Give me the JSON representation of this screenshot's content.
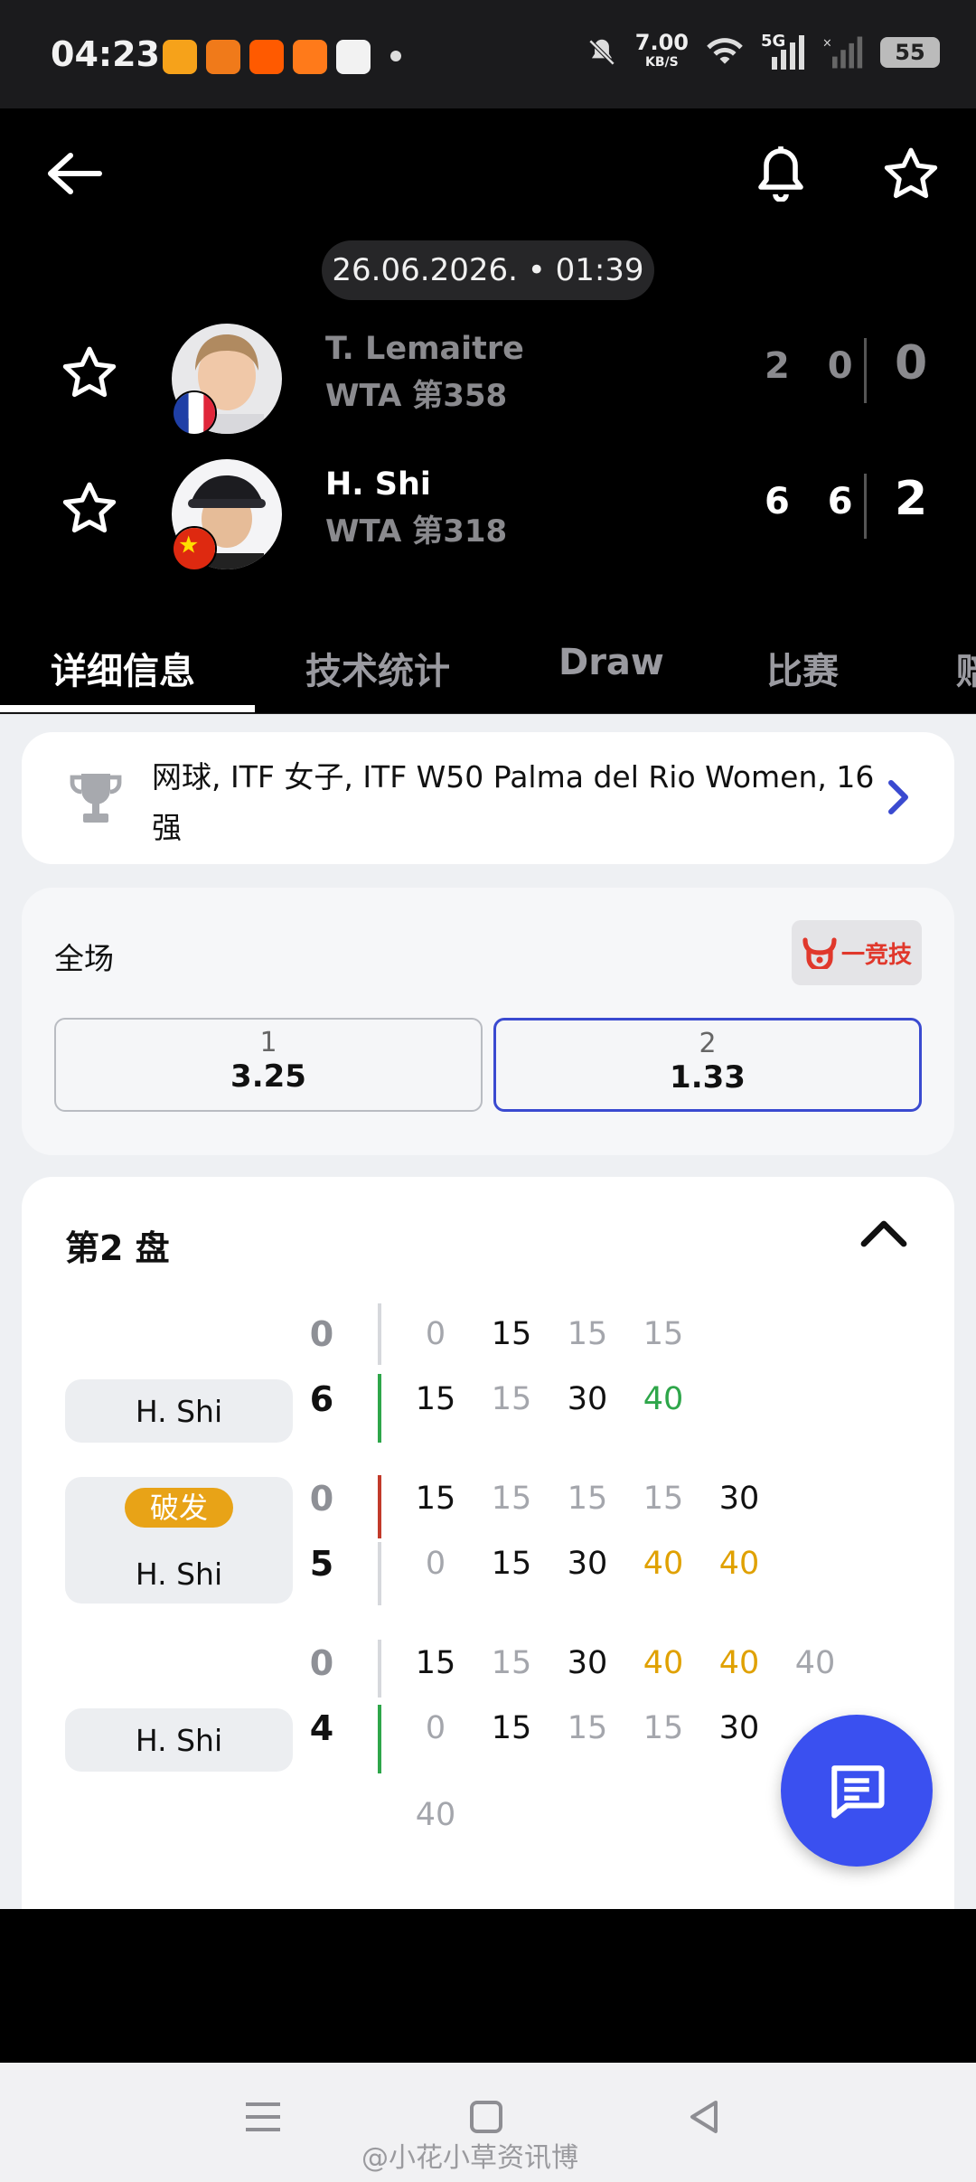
{
  "status_bar": {
    "time": "04:23",
    "speed_value": "7.00",
    "speed_unit": "KB/S",
    "network": "5G",
    "battery": "55",
    "app_icons": [
      "weibo-icon",
      "app-store-icon",
      "taobao-icon",
      "meituan-icon",
      "photos-icon"
    ]
  },
  "header": {
    "datetime": "26.06.2026. • 01:39",
    "players": [
      {
        "name": "T. Lemaitre",
        "rank": "WTA 第358",
        "country": "France",
        "sets": "2 0",
        "total": "0",
        "dimmed": true
      },
      {
        "name": "H. Shi",
        "rank": "WTA 第318",
        "country": "China",
        "sets": "6 6",
        "total": "2",
        "dimmed": false
      }
    ]
  },
  "tabs": [
    "详细信息",
    "技术统计",
    "Draw",
    "比赛",
    "赔"
  ],
  "active_tab": 0,
  "competition": {
    "text": "网球, ITF 女子, ITF W50 Palma del Rio Women, 16强"
  },
  "odds": {
    "title": "全场",
    "bookmaker": "一竞技",
    "options": [
      {
        "label": "1",
        "value": "3.25",
        "selected": false
      },
      {
        "label": "2",
        "value": "1.33",
        "selected": true
      }
    ]
  },
  "set_section": {
    "title": "第2 盘",
    "games": [
      {
        "server": "H. Shi",
        "badge": "",
        "top_score": "0",
        "bottom_score": "6",
        "top_points": [
          "0",
          "15",
          "15",
          "15"
        ],
        "bottom_points": [
          "15",
          "15",
          "30",
          "40"
        ]
      },
      {
        "server": "H. Shi",
        "badge": "破发",
        "top_score": "0",
        "bottom_score": "5",
        "top_points": [
          "15",
          "15",
          "15",
          "15",
          "30"
        ],
        "bottom_points": [
          "0",
          "15",
          "30",
          "40",
          "40"
        ]
      },
      {
        "server": "H. Shi",
        "badge": "",
        "top_score": "0",
        "bottom_score": "4",
        "top_points": [
          "15",
          "15",
          "30",
          "40",
          "40",
          "40"
        ],
        "bottom_points": [
          "0",
          "15",
          "15",
          "15",
          "30"
        ],
        "overflow_point": "40"
      }
    ]
  },
  "watermark": "@小花小草资讯博",
  "colors": {
    "accent_blue": "#3a50f0",
    "serve_green": "#2ea64a",
    "break_red": "#c23a2a",
    "badge_orange": "#e8a317"
  }
}
